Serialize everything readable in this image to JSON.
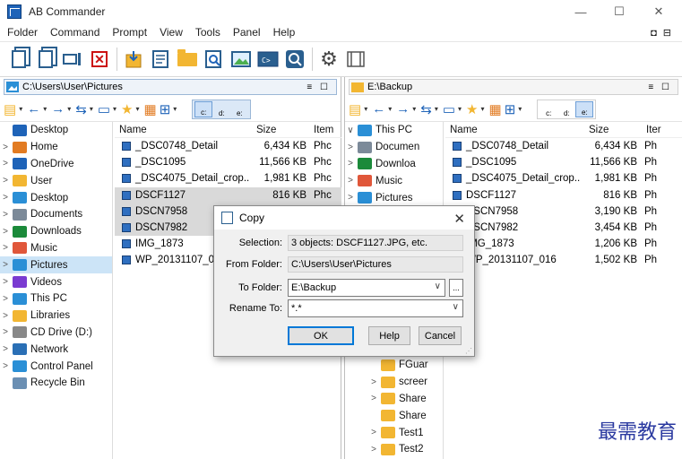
{
  "window": {
    "title": "AB Commander",
    "min": "—",
    "max": "☐",
    "close": "✕"
  },
  "menu": {
    "items": [
      "Folder",
      "Command",
      "Prompt",
      "View",
      "Tools",
      "Panel",
      "Help"
    ],
    "right_icons": "◘ ⊟"
  },
  "left_panel": {
    "path": "C:\\Users\\User\\Pictures",
    "pane_buttons": "≡ ☐",
    "tree": [
      {
        "label": "Desktop",
        "chev": "",
        "icon": "desktop-icon",
        "color": "#1e63b8"
      },
      {
        "label": "Home",
        "chev": ">",
        "icon": "home-icon",
        "color": "#e27b22"
      },
      {
        "label": "OneDrive",
        "chev": ">",
        "icon": "cloud-icon",
        "color": "#1e63b8"
      },
      {
        "label": "User",
        "chev": ">",
        "icon": "folder-icon",
        "color": "#f2b632"
      },
      {
        "label": "Desktop",
        "chev": ">",
        "icon": "desktop-icon",
        "color": "#2a8fd6"
      },
      {
        "label": "Documents",
        "chev": ">",
        "icon": "documents-icon",
        "color": "#7c8a99"
      },
      {
        "label": "Downloads",
        "chev": ">",
        "icon": "downloads-icon",
        "color": "#1b8a3a"
      },
      {
        "label": "Music",
        "chev": ">",
        "icon": "music-icon",
        "color": "#e0573a"
      },
      {
        "label": "Pictures",
        "chev": ">",
        "icon": "pictures-icon",
        "color": "#2a8fd6",
        "selected": true
      },
      {
        "label": "Videos",
        "chev": ">",
        "icon": "videos-icon",
        "color": "#7a3bd1"
      },
      {
        "label": "This PC",
        "chev": ">",
        "icon": "pc-icon",
        "color": "#2a8fd6"
      },
      {
        "label": "Libraries",
        "chev": ">",
        "icon": "folder-icon",
        "color": "#f2b632"
      },
      {
        "label": "CD Drive (D:)",
        "chev": ">",
        "icon": "cd-drive-icon",
        "color": "#888888"
      },
      {
        "label": "Network",
        "chev": ">",
        "icon": "network-icon",
        "color": "#2a6fb5"
      },
      {
        "label": "Control Panel",
        "chev": ">",
        "icon": "control-panel-icon",
        "color": "#2a8fd6"
      },
      {
        "label": "Recycle Bin",
        "chev": "",
        "icon": "recycle-bin-icon",
        "color": "#6b8fb3"
      }
    ],
    "columns": {
      "name": "Name",
      "size": "Size",
      "item": "Item"
    },
    "files": [
      {
        "name": "_DSC0748_Detail",
        "size": "6,434 KB",
        "item": "Phc",
        "selected": false
      },
      {
        "name": "_DSC1095",
        "size": "11,566 KB",
        "item": "Phc",
        "selected": false
      },
      {
        "name": "_DSC4075_Detail_crop...",
        "size": "1,981 KB",
        "item": "Phc",
        "selected": false
      },
      {
        "name": "DSCF1127",
        "size": "816 KB",
        "item": "Phc",
        "selected": true
      },
      {
        "name": "DSCN7958",
        "size": "",
        "item": "",
        "selected": true
      },
      {
        "name": "DSCN7982",
        "size": "",
        "item": "",
        "selected": true
      },
      {
        "name": "IMG_1873",
        "size": "",
        "item": "",
        "selected": false
      },
      {
        "name": "WP_20131107_016",
        "size": "",
        "item": "",
        "selected": false
      }
    ]
  },
  "right_panel": {
    "path": "E:\\Backup",
    "pane_buttons": "≡ ☐",
    "tree": [
      {
        "label": "This PC",
        "chev": "∨",
        "icon": "pc-icon",
        "color": "#2a8fd6"
      },
      {
        "label": "Documen",
        "chev": ">",
        "icon": "documents-icon",
        "color": "#7c8a99"
      },
      {
        "label": "Downloa",
        "chev": ">",
        "icon": "downloads-icon",
        "color": "#1b8a3a"
      },
      {
        "label": "Music",
        "chev": ">",
        "icon": "music-icon",
        "color": "#e0573a"
      },
      {
        "label": "Pictures",
        "chev": ">",
        "icon": "pictures-icon",
        "color": "#2a8fd6"
      }
    ],
    "tree_bottom": [
      {
        "label": "FGuar",
        "chev": "",
        "icon": "folder-icon",
        "color": "#f2b632"
      },
      {
        "label": "screer",
        "chev": ">",
        "icon": "folder-icon",
        "color": "#f2b632"
      },
      {
        "label": "Share",
        "chev": ">",
        "icon": "folder-icon",
        "color": "#f2b632"
      },
      {
        "label": "Share",
        "chev": "",
        "icon": "folder-icon",
        "color": "#f2b632"
      },
      {
        "label": "Test1",
        "chev": ">",
        "icon": "folder-icon",
        "color": "#f2b632"
      },
      {
        "label": "Test2",
        "chev": ">",
        "icon": "folder-icon",
        "color": "#f2b632"
      }
    ],
    "columns": {
      "name": "Name",
      "size": "Size",
      "item": "Iter"
    },
    "files": [
      {
        "name": "_DSC0748_Detail",
        "size": "6,434 KB",
        "item": "Ph"
      },
      {
        "name": "_DSC1095",
        "size": "11,566 KB",
        "item": "Ph"
      },
      {
        "name": "_DSC4075_Detail_crop...",
        "size": "1,981 KB",
        "item": "Ph"
      },
      {
        "name": "DSCF1127",
        "size": "816 KB",
        "item": "Ph"
      },
      {
        "name": "DSCN7958",
        "size": "3,190 KB",
        "item": "Ph"
      },
      {
        "name": "DSCN7982",
        "size": "3,454 KB",
        "item": "Ph"
      },
      {
        "name": "IMG_1873",
        "size": "1,206 KB",
        "item": "Ph"
      },
      {
        "name": "WP_20131107_016",
        "size": "1,502 KB",
        "item": "Ph"
      }
    ]
  },
  "drives": [
    "c:",
    "d:",
    "e:"
  ],
  "dialog": {
    "title": "Copy",
    "selection_label": "Selection:",
    "selection_value": "3 objects: DSCF1127.JPG, etc.",
    "from_label": "From Folder:",
    "from_value": "C:\\Users\\User\\Pictures",
    "to_label": "To Folder:",
    "to_value": "E:\\Backup",
    "rename_label": "Rename To:",
    "rename_value": "*.*",
    "ok": "OK",
    "help": "Help",
    "cancel": "Cancel",
    "browse": "..."
  },
  "watermark": "最需教育"
}
